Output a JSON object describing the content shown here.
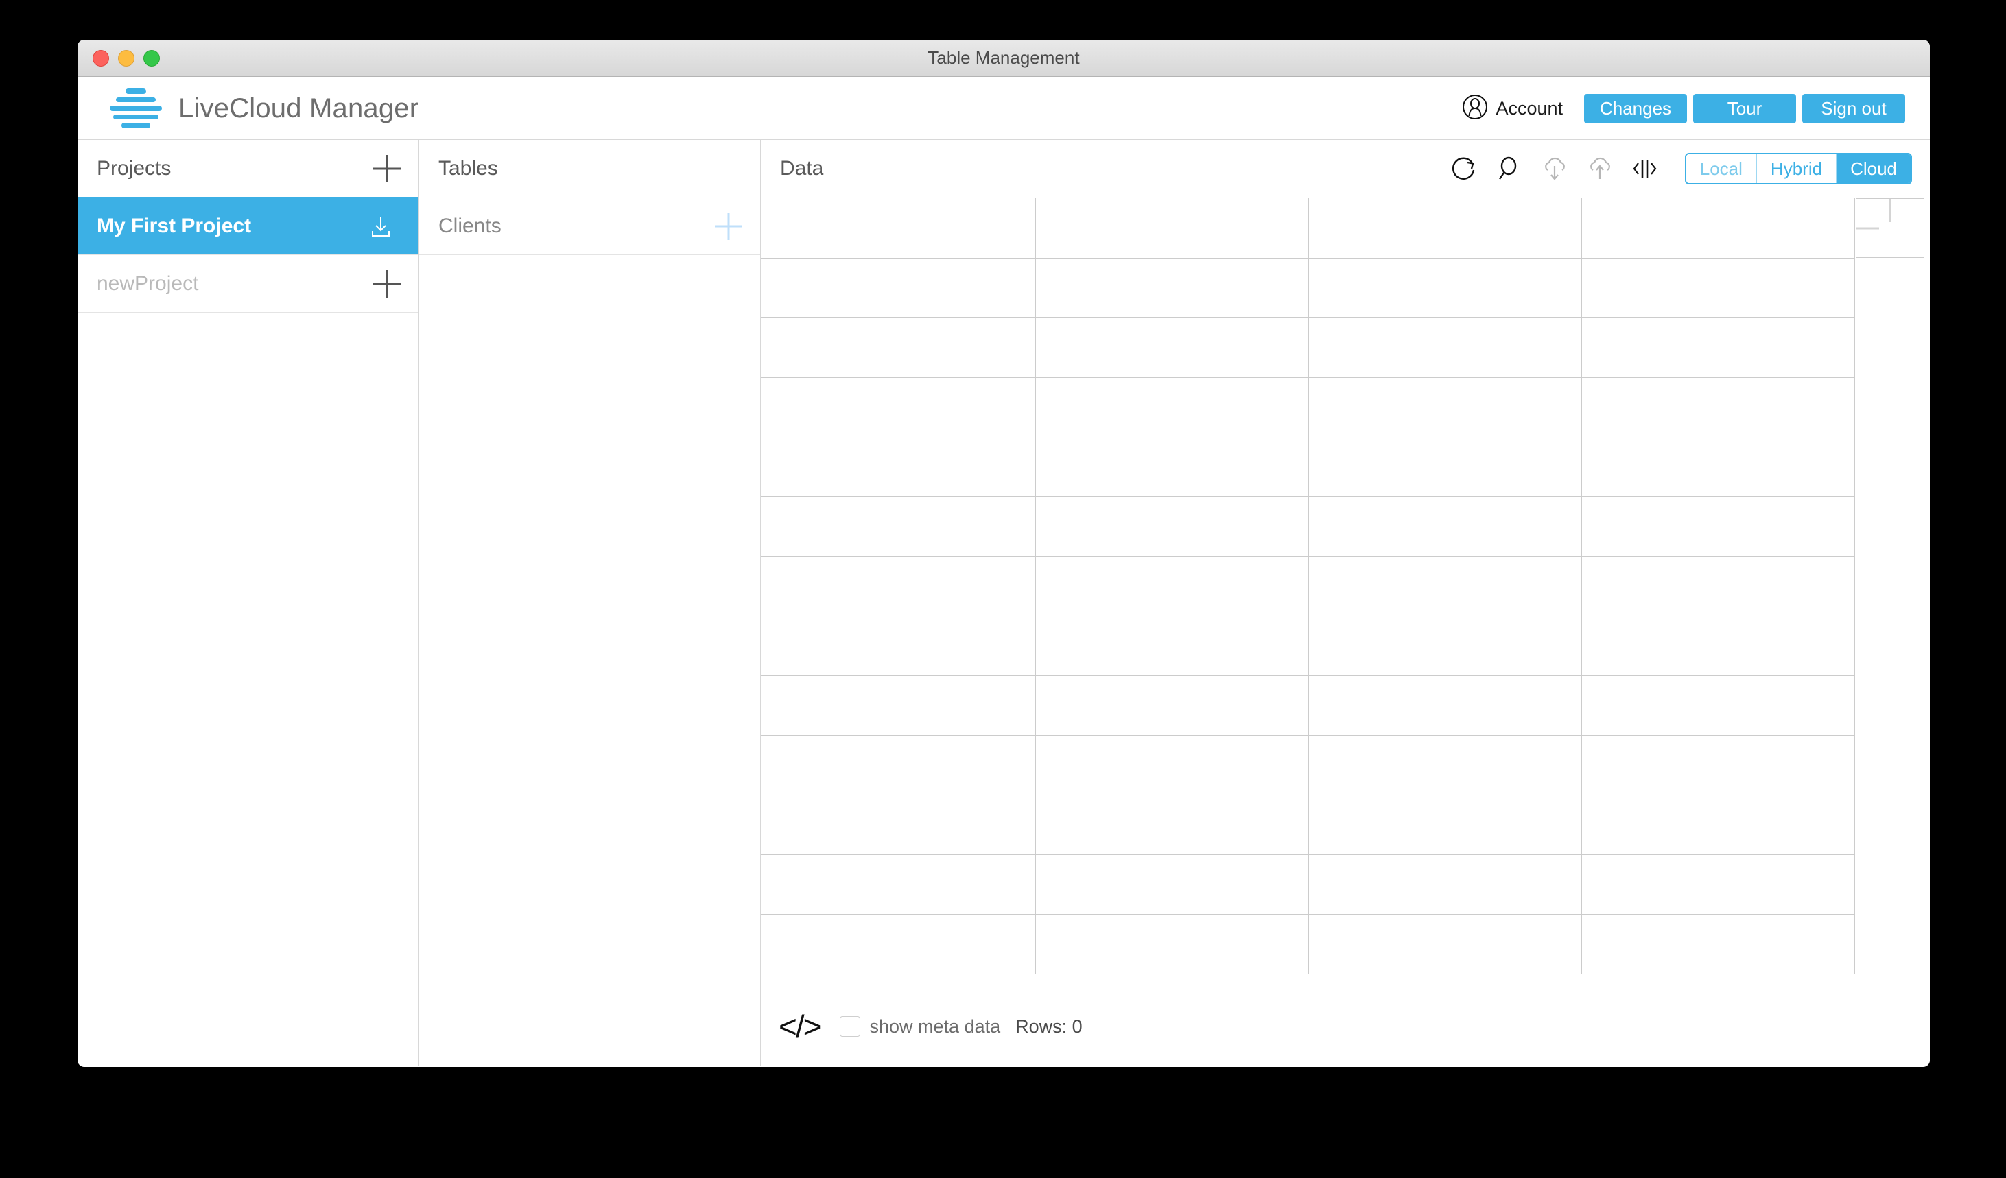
{
  "window": {
    "title": "Table Management",
    "traffic_lights": [
      "close-button",
      "minimize-button",
      "maximize-button"
    ]
  },
  "header": {
    "brand_name": "LiveCloud Manager",
    "logo_icon": "livecloud-stack-logo",
    "account": {
      "icon": "account-person-icon",
      "label": "Account"
    },
    "buttons": [
      {
        "label": "Changes",
        "name": "changes-button"
      },
      {
        "label": "Tour",
        "name": "tour-button"
      },
      {
        "label": "Sign out",
        "name": "sign-out-button"
      }
    ],
    "accent_color": "#3cb0e5"
  },
  "projects": {
    "title": "Projects",
    "add_icon": "plus-icon",
    "items": [
      {
        "label": "My First Project",
        "selected": true,
        "trailing_icon": "download-icon"
      },
      {
        "label": "newProject",
        "selected": false,
        "trailing_icon": "plus-icon"
      }
    ]
  },
  "tables": {
    "title": "Tables",
    "items": [
      {
        "label": "Clients",
        "trailing_icon": "plus-icon"
      }
    ]
  },
  "data": {
    "title": "Data",
    "toolbar_icons": [
      "refresh-icon",
      "search-icon",
      "cloud-download-icon",
      "cloud-upload-icon",
      "split-pane-icon"
    ],
    "segmented_control": {
      "options": [
        "Local",
        "Hybrid",
        "Cloud"
      ],
      "selected": "Cloud"
    },
    "add_column_icon": "plus-icon",
    "grid": {
      "columns": 4,
      "rows": 13,
      "cells": []
    }
  },
  "footer": {
    "code_icon": "code-brackets-icon",
    "code_icon_glyph": "</>",
    "show_meta_data": {
      "label": "show meta data",
      "checked": false
    },
    "rows_label": "Rows: 0"
  }
}
